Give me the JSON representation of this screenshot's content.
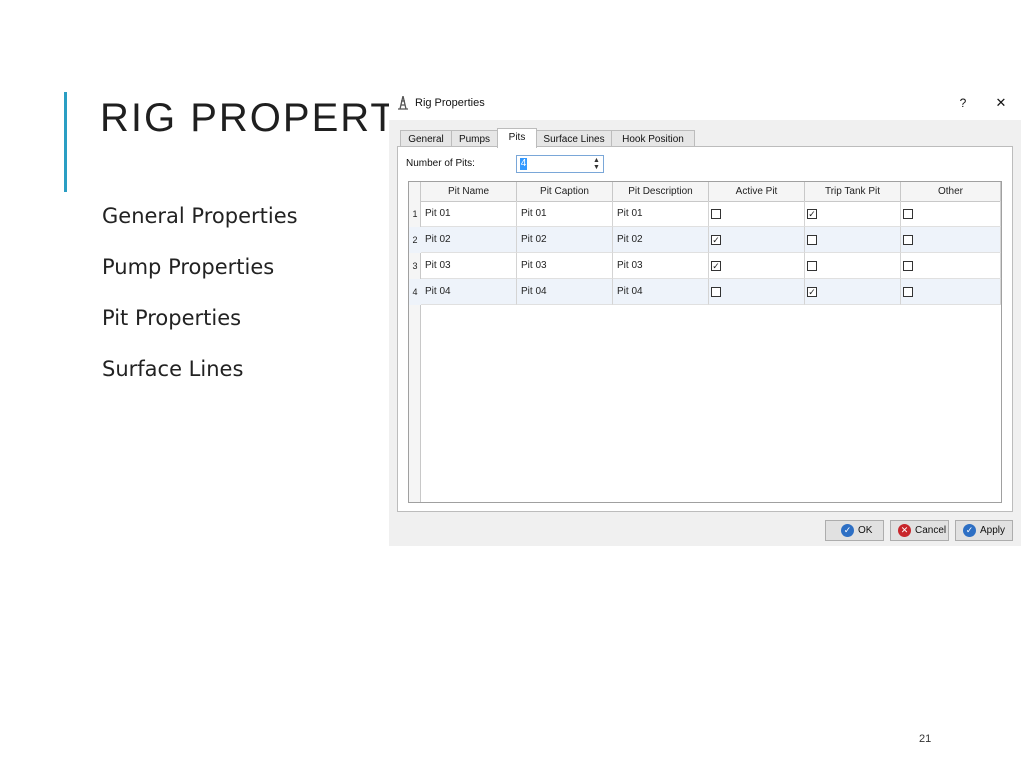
{
  "slide": {
    "title": "RIG PROPERTIES",
    "bullets": [
      "General Properties",
      "Pump Properties",
      "Pit Properties",
      "Surface Lines"
    ],
    "page_number": "21",
    "accent_color": "#2a9ec3"
  },
  "dialog": {
    "title": "Rig Properties",
    "help_label": "?",
    "close_label": "✕",
    "tabs": [
      {
        "label": "General"
      },
      {
        "label": "Pumps"
      },
      {
        "label": "Pits"
      },
      {
        "label": "Surface Lines"
      },
      {
        "label": "Hook Position"
      }
    ],
    "active_tab": "Pits",
    "number_of_pits_label": "Number of Pits:",
    "number_of_pits_value": "4",
    "spin_up_glyph": "▲",
    "spin_down_glyph": "▼",
    "columns": [
      "Pit Name",
      "Pit Caption",
      "Pit Description",
      "Active Pit",
      "Trip Tank Pit",
      "Other"
    ],
    "rows": [
      {
        "num": "1",
        "name": "Pit 01",
        "caption": "Pit 01",
        "description": "Pit 01",
        "active": false,
        "trip_tank": true,
        "other": false
      },
      {
        "num": "2",
        "name": "Pit 02",
        "caption": "Pit 02",
        "description": "Pit 02",
        "active": true,
        "trip_tank": false,
        "other": false
      },
      {
        "num": "3",
        "name": "Pit 03",
        "caption": "Pit 03",
        "description": "Pit 03",
        "active": true,
        "trip_tank": false,
        "other": false
      },
      {
        "num": "4",
        "name": "Pit 04",
        "caption": "Pit 04",
        "description": "Pit 04",
        "active": false,
        "trip_tank": true,
        "other": false
      }
    ],
    "buttons": {
      "ok": {
        "label": "OK",
        "icon": "check-icon"
      },
      "cancel": {
        "label": "Cancel",
        "icon": "cancel-icon"
      },
      "apply": {
        "label": "Apply",
        "icon": "check-icon"
      }
    },
    "icon_glyphs": {
      "check": "✓",
      "cancel": "✕"
    }
  }
}
